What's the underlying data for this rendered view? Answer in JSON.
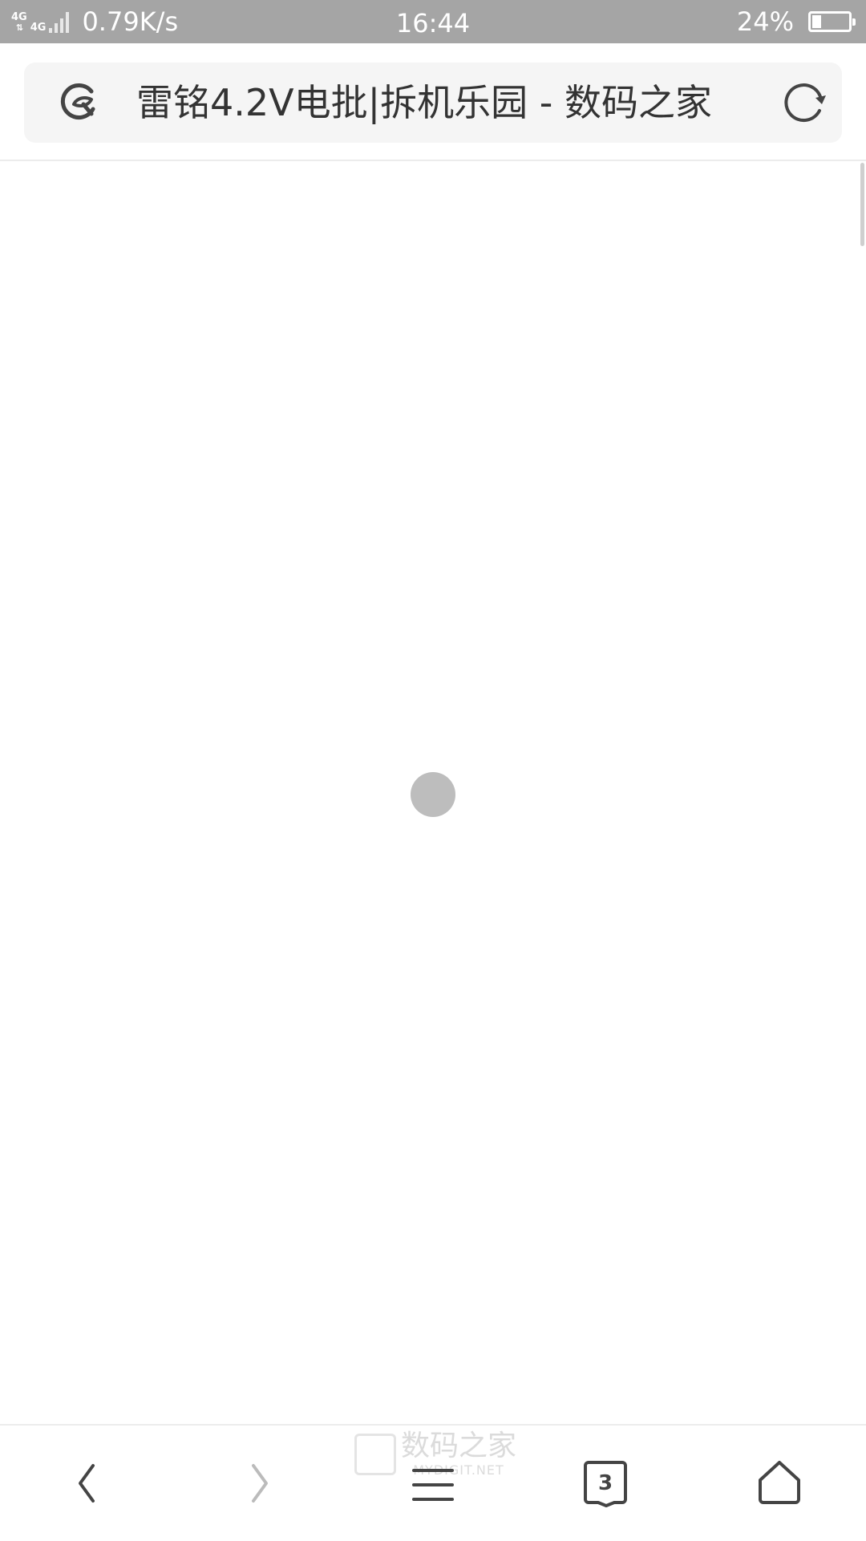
{
  "status_bar": {
    "network_1": "4G",
    "network_2": "4G",
    "speed": "0.79K/s",
    "time": "16:44",
    "battery_percent": "24%",
    "battery_level": 0.24
  },
  "address_bar": {
    "page_title": "雷铭4.2V电批|拆机乐园 - 数码之家"
  },
  "content": {
    "state": "loading"
  },
  "bottom_nav": {
    "tab_count": "3",
    "forward_enabled": false
  },
  "watermark": {
    "cn": "数码之家",
    "en": "MYDIGIT.NET"
  },
  "colors": {
    "status_bar_bg": "#a5a5a5",
    "addr_bg": "#f5f5f5",
    "icon_dark": "#444444",
    "icon_disabled": "#bbbbbb",
    "loading_dot": "#bdbdbd"
  }
}
